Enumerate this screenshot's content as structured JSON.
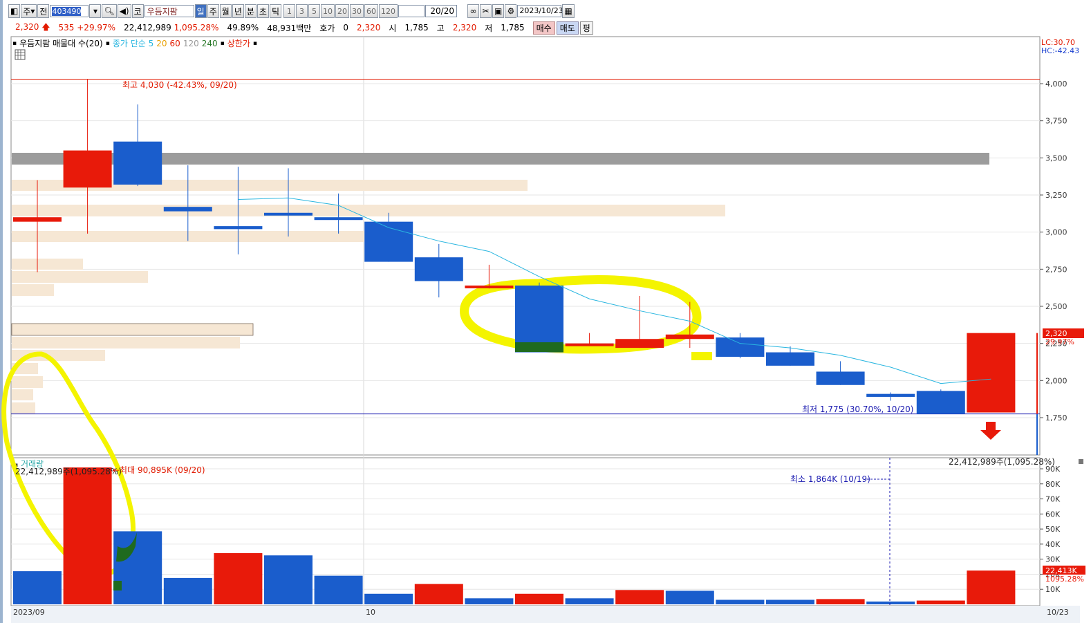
{
  "toolbar": {
    "market": "주",
    "prev": "전",
    "code": "403490",
    "exchange": "코",
    "name": "우듬지팜",
    "periods": [
      "일",
      "주",
      "월",
      "년",
      "분",
      "초",
      "틱"
    ],
    "active_period": "일",
    "intervals": [
      "1",
      "3",
      "5",
      "10",
      "20",
      "30",
      "60",
      "120"
    ],
    "count": "20/20",
    "date": "2023/10/23"
  },
  "quote": {
    "price": "2,320",
    "change": "535 +29.97%",
    "volume": "22,412,989",
    "volume_ratio": "1,095.28%",
    "turnover": "49.89%",
    "amount": "48,931백만",
    "bid_label": "호가",
    "bid_qty": "0",
    "bid_price": "2,320",
    "open_label": "시",
    "open": "1,785",
    "high_label": "고",
    "high": "2,320",
    "low_label": "저",
    "low": "1,785",
    "buy": "매수",
    "sell": "매도",
    "avg": "평"
  },
  "legend": {
    "title": "우듬지팜 매물대 수(20)",
    "ma_label": "종가 단순 5",
    "ma20": "20",
    "ma60": "60",
    "ma120": "120",
    "ma240": "240",
    "limit_up": "상한가"
  },
  "right_labels": {
    "lc": "LC:30.70",
    "hc": "HC:-42.43",
    "price": "2,320",
    "pct": "29.97%",
    "vol": "22,413K",
    "vol_pct": "1095.28%"
  },
  "annotations": {
    "high": "최고 4,030 (-42.43%, 09/20)",
    "low": "최저 1,775 (30.70%, 10/20)",
    "vol_max": "최대 90,895K (09/20)",
    "vol_min": "최소 1,864K (10/19)",
    "vol_current": "22,412,989주(1,095.28%)",
    "vol_left": "22,412,989주(1,095.28%)"
  },
  "volume_title": "거래량",
  "x_labels": [
    "2023/09",
    "10",
    "10/23"
  ],
  "colors": {
    "up": "#e81a0a",
    "down": "#1a5dcc",
    "ma": "#29b6e0",
    "highlight": "#f4f400"
  },
  "chart_data": [
    {
      "type": "candlestick",
      "ylim": [
        1500,
        4200
      ],
      "yticks": [
        1750,
        2000,
        2250,
        2500,
        2750,
        3000,
        3250,
        3500,
        3750,
        4000
      ],
      "candles": [
        {
          "o": 3070,
          "h": 3350,
          "l": 2730,
          "c": 3100
        },
        {
          "o": 3300,
          "h": 4030,
          "l": 2990,
          "c": 3550
        },
        {
          "o": 3610,
          "h": 3860,
          "l": 3310,
          "c": 3320
        },
        {
          "o": 3170,
          "h": 3450,
          "l": 2940,
          "c": 3140
        },
        {
          "o": 3040,
          "h": 3440,
          "l": 2850,
          "c": 3020
        },
        {
          "o": 3130,
          "h": 3430,
          "l": 2970,
          "c": 3120
        },
        {
          "o": 3100,
          "h": 3260,
          "l": 2990,
          "c": 3090
        },
        {
          "o": 3070,
          "h": 3130,
          "l": 2800,
          "c": 2800
        },
        {
          "o": 2830,
          "h": 2920,
          "l": 2560,
          "c": 2670
        },
        {
          "o": 2630,
          "h": 2780,
          "l": 2620,
          "c": 2640
        },
        {
          "o": 2640,
          "h": 2660,
          "l": 2190,
          "c": 2190
        },
        {
          "o": 2240,
          "h": 2320,
          "l": 2240,
          "c": 2250
        },
        {
          "o": 2220,
          "h": 2570,
          "l": 2220,
          "c": 2280
        },
        {
          "o": 2280,
          "h": 2530,
          "l": 2220,
          "c": 2310
        },
        {
          "o": 2290,
          "h": 2320,
          "l": 2150,
          "c": 2160
        },
        {
          "o": 2190,
          "h": 2230,
          "l": 2100,
          "c": 2100
        },
        {
          "o": 2060,
          "h": 2130,
          "l": 1970,
          "c": 1970
        },
        {
          "o": 1910,
          "h": 1920,
          "l": 1864,
          "c": 1890
        },
        {
          "o": 1930,
          "h": 1940,
          "l": 1775,
          "c": 1775
        },
        {
          "o": 1785,
          "h": 2320,
          "l": 1785,
          "c": 2320
        }
      ],
      "ma5": [
        null,
        null,
        null,
        null,
        3220,
        3230,
        3180,
        3030,
        2940,
        2870,
        2700,
        2550,
        2470,
        2400,
        2250,
        2220,
        2170,
        2090,
        1980,
        2010
      ]
    },
    {
      "type": "bar",
      "ylabel": "거래량",
      "ylim": [
        0,
        95000
      ],
      "yticks": [
        10000,
        20000,
        30000,
        40000,
        50000,
        60000,
        70000,
        80000,
        90000
      ],
      "unit": "K",
      "values": [
        22000,
        90895,
        48500,
        17500,
        34000,
        32500,
        19000,
        7000,
        13500,
        4000,
        7000,
        4000,
        9500,
        9000,
        3000,
        3000,
        3500,
        1864,
        2500,
        22413
      ],
      "colors": [
        "down",
        "up",
        "down",
        "down",
        "up",
        "down",
        "down",
        "down",
        "up",
        "down",
        "up",
        "down",
        "up",
        "down",
        "down",
        "down",
        "up",
        "down",
        "up",
        "up"
      ]
    }
  ]
}
